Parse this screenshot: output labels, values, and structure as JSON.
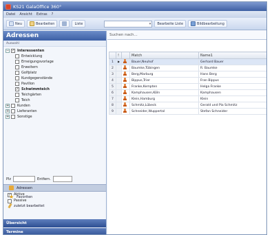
{
  "window": {
    "title": "KS21 GalaOffice 360°"
  },
  "menu": [
    "Datei",
    "Ansicht",
    "Extras",
    "?"
  ],
  "toolbar": {
    "new_label": "Neu",
    "edit_label": "Bearbeiten",
    "list_label": "Liste",
    "edit_list_label": "Bearbeite Liste",
    "show_map_label": "Bildbearbeitung"
  },
  "sidebar": {
    "header": "Adressen",
    "subheader": "Auswahl",
    "tree": [
      {
        "label": "Interessenten",
        "level": 1,
        "expanded": true,
        "checked": true,
        "bold": true
      },
      {
        "label": "Entwicklung",
        "level": 2,
        "checked": false
      },
      {
        "label": "Erneigungsvorlage",
        "level": 2,
        "checked": false
      },
      {
        "label": "Erweitern",
        "level": 2,
        "checked": false
      },
      {
        "label": "Golfplatz",
        "level": 2,
        "checked": false
      },
      {
        "label": "Kundgegenstände",
        "level": 2,
        "checked": false
      },
      {
        "label": "Pavillon",
        "level": 2,
        "checked": false
      },
      {
        "label": "Schwimmteich",
        "level": 2,
        "checked": true,
        "bold": true
      },
      {
        "label": "Teichgärten",
        "level": 2,
        "checked": false
      },
      {
        "label": "Teich",
        "level": 2,
        "checked": false
      },
      {
        "label": "Kunden",
        "level": 1,
        "expanded": false,
        "checked": false
      },
      {
        "label": "Lieferanten",
        "level": 1,
        "expanded": false,
        "checked": false
      },
      {
        "label": "Sonstige",
        "level": 1,
        "expanded": false,
        "checked": false
      }
    ],
    "plz_label": "Plz",
    "distance_label": "Entfern.",
    "options": [
      {
        "label": "Aktive",
        "checked": true
      },
      {
        "label": "Passive",
        "checked": false
      }
    ],
    "nav": [
      {
        "label": "Adressen",
        "selected": true
      },
      {
        "label": "Favoriten",
        "selected": false
      },
      {
        "label": "zuletzt bearbeitet",
        "selected": false
      }
    ],
    "bottom": [
      "Übersicht",
      "Termine"
    ]
  },
  "main": {
    "search_placeholder": "Suchen nach...",
    "columns": [
      "",
      "!",
      "Match",
      "Name1"
    ],
    "rows": [
      {
        "num": "1",
        "match": "Bauer,Neuhof",
        "name": "Gerhard Bauer",
        "selected": true
      },
      {
        "num": "2",
        "match": "Baumke,Tübingen",
        "name": "R. Baumke"
      },
      {
        "num": "3",
        "match": "Berg,Marburg",
        "name": "Hans Berg"
      },
      {
        "num": "4",
        "match": "Bippus,Trier",
        "name": "Fran Bippus"
      },
      {
        "num": "5",
        "match": "Franke,Kempten",
        "name": "Helga Franke"
      },
      {
        "num": "6",
        "match": "Kamphausen,Köln",
        "name": "Kamphausen"
      },
      {
        "num": "7",
        "match": "Klein,Hamburg",
        "name": "Klein"
      },
      {
        "num": "8",
        "match": "Schmitz,Lübeck",
        "name": "Gerald und Pia Schmitz"
      },
      {
        "num": "9",
        "match": "Schneider,Wuppertal",
        "name": "Stefan Schneider"
      }
    ]
  },
  "colors": {
    "title_gradient_top": "#7f9ad0",
    "title_gradient_bottom": "#3d5fa3",
    "person_icon": "#e27b2c",
    "selected_row": "#dce6f6"
  }
}
